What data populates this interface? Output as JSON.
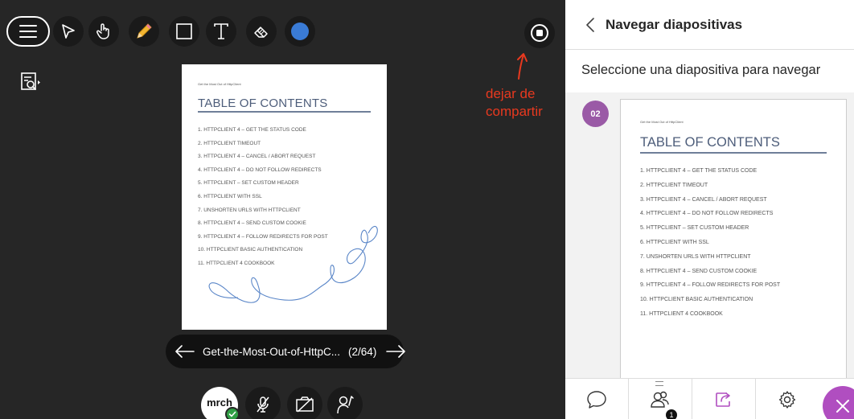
{
  "colors": {
    "accent": "#b04ec0",
    "badge": "#9a5aa6",
    "annotation": "#e8391f",
    "stage_bg": "#262626",
    "color_tool": "#3a7bd5"
  },
  "toolbar": {
    "tools": [
      "menu-icon",
      "pointer-icon",
      "hand-icon",
      "pencil-icon",
      "rectangle-icon",
      "text-icon",
      "eraser-icon",
      "color-icon"
    ]
  },
  "annotation": {
    "line1": "dejar de",
    "line2": "compartir"
  },
  "slide": {
    "small_text": "Get the Most Out of HttpClient",
    "title": "TABLE OF CONTENTS",
    "items": [
      "1. HTTPCLIENT 4 – GET THE STATUS CODE",
      "2. HTTPCLIENT TIMEOUT",
      "3. HTTPCLIENT 4 – CANCEL / ABORT REQUEST",
      "4. HTTPCLIENT 4 – DO NOT FOLLOW REDIRECTS",
      "5. HTTPCLIENT – SET CUSTOM HEADER",
      "6. HTTPCLIENT WITH SSL",
      "7. UNSHORTEN URLS WITH HTTPCLIENT",
      "8. HTTPCLIENT 4 – SEND CUSTOM COOKIE",
      "9. HTTPCLIENT 4 – FOLLOW REDIRECTS FOR POST",
      "10. HTTPCLIENT BASIC AUTHENTICATION",
      "11. HTTPCLIENT 4 COOKBOOK"
    ]
  },
  "slide_nav": {
    "file_name": "Get-the-Most-Out-of-HttpC...",
    "position": "(2/64)"
  },
  "user": {
    "initials": "mrch"
  },
  "panel": {
    "title": "Navegar diapositivas",
    "instruction": "Seleccione una diapositiva para navegar",
    "slides": [
      {
        "number": "02",
        "small_text": "Get the Most Out of HttpClient",
        "title": "TABLE OF CONTENTS",
        "items": [
          "1. HTTPCLIENT 4 – GET THE STATUS CODE",
          "2. HTTPCLIENT TIMEOUT",
          "3. HTTPCLIENT 4 – CANCEL / ABORT REQUEST",
          "4. HTTPCLIENT 4 – DO NOT FOLLOW REDIRECTS",
          "5. HTTPCLIENT – SET CUSTOM HEADER",
          "6. HTTPCLIENT WITH SSL",
          "7. UNSHORTEN URLS WITH HTTPCLIENT",
          "8. HTTPCLIENT 4 – SEND CUSTOM COOKIE",
          "9. HTTPCLIENT 4 – FOLLOW REDIRECTS FOR POST",
          "10. HTTPCLIENT BASIC AUTHENTICATION",
          "11. HTTPCLIENT 4 COOKBOOK"
        ]
      }
    ],
    "participants_count": "1"
  }
}
